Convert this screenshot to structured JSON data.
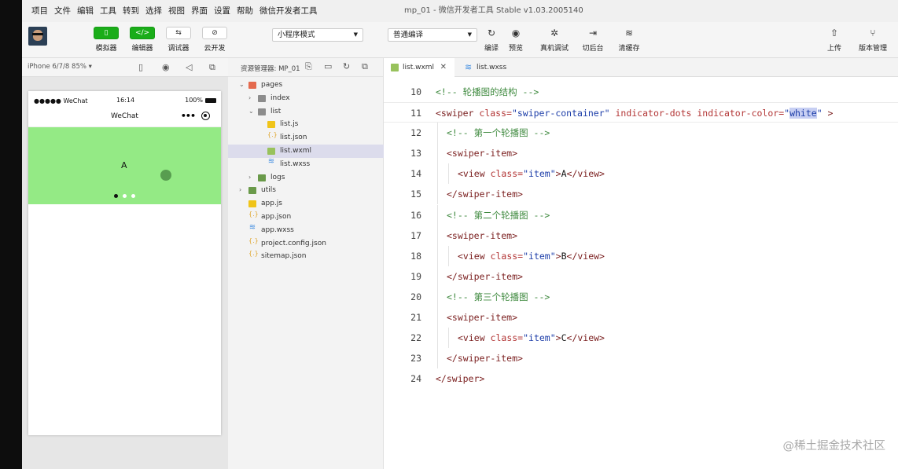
{
  "window": {
    "title": "mp_01 - 微信开发者工具 Stable v1.03.2005140"
  },
  "menu": [
    "项目",
    "文件",
    "编辑",
    "工具",
    "转到",
    "选择",
    "视图",
    "界面",
    "设置",
    "帮助",
    "微信开发者工具"
  ],
  "toolbar": {
    "simulator": {
      "label": "模拟器",
      "glyph": "▯"
    },
    "editor": {
      "label": "编辑器",
      "glyph": "</>"
    },
    "debugger": {
      "label": "调试器",
      "glyph": "⇆"
    },
    "cloud": {
      "label": "云开发",
      "glyph": "⊘"
    },
    "mode_select": "小程序模式",
    "compile_select": "普通编译",
    "compile": {
      "label": "编译",
      "glyph": "↻"
    },
    "preview": {
      "label": "预览",
      "glyph": "◉"
    },
    "remote_debug": {
      "label": "真机调试",
      "glyph": "✲"
    },
    "background": {
      "label": "切后台",
      "glyph": "⇥"
    },
    "clear_cache": {
      "label": "清缓存",
      "glyph": "≋"
    },
    "upload": {
      "label": "上传",
      "glyph": "⇧"
    },
    "version": {
      "label": "版本管理",
      "glyph": "⑂"
    }
  },
  "simulator": {
    "device": "iPhone 6/7/8 85% ▾",
    "status_signal": "●●●●● WeChat",
    "status_time": "16:14",
    "status_battery": "100%",
    "nav_title": "WeChat",
    "swiper_item": "A",
    "swiper_color": "#94ea85",
    "indicator_active": 0,
    "indicator_count": 3
  },
  "explorer": {
    "title": "资源管理器: MP_01",
    "tree": [
      {
        "name": "pages",
        "indent": 0,
        "arrow": "⌄",
        "icon": "foldr"
      },
      {
        "name": "index",
        "indent": 1,
        "arrow": "›",
        "icon": "fold"
      },
      {
        "name": "list",
        "indent": 1,
        "arrow": "⌄",
        "icon": "fold"
      },
      {
        "name": "list.js",
        "indent": 2,
        "arrow": "",
        "icon": "js"
      },
      {
        "name": "list.json",
        "indent": 2,
        "arrow": "",
        "icon": "json"
      },
      {
        "name": "list.wxml",
        "indent": 2,
        "arrow": "",
        "icon": "wxml",
        "selected": true
      },
      {
        "name": "list.wxss",
        "indent": 2,
        "arrow": "",
        "icon": "wxss"
      },
      {
        "name": "logs",
        "indent": 1,
        "arrow": "›",
        "icon": "foldg"
      },
      {
        "name": "utils",
        "indent": 0,
        "arrow": "›",
        "icon": "foldg"
      },
      {
        "name": "app.js",
        "indent": 0,
        "arrow": "",
        "icon": "js"
      },
      {
        "name": "app.json",
        "indent": 0,
        "arrow": "",
        "icon": "json"
      },
      {
        "name": "app.wxss",
        "indent": 0,
        "arrow": "",
        "icon": "wxss"
      },
      {
        "name": "project.config.json",
        "indent": 0,
        "arrow": "",
        "icon": "json"
      },
      {
        "name": "sitemap.json",
        "indent": 0,
        "arrow": "",
        "icon": "json"
      }
    ]
  },
  "editor": {
    "tabs": [
      {
        "label": "list.wxml",
        "active": true,
        "close": "✕"
      },
      {
        "label": "list.wxss",
        "active": false
      }
    ],
    "lines": [
      {
        "n": "10",
        "indent": 0,
        "tokens": [
          {
            "t": "<!-- 轮播图的结构 -->",
            "c": "com"
          }
        ]
      },
      {
        "n": "11",
        "indent": 0,
        "hl": true,
        "tokens": [
          {
            "t": "<swiper ",
            "c": "tag"
          },
          {
            "t": "class=",
            "c": "attr"
          },
          {
            "t": "\"swiper-container\"",
            "c": "str"
          },
          {
            "t": " indicator-dots ",
            "c": "attr"
          },
          {
            "t": "indicator-color=",
            "c": "attr"
          },
          {
            "t": "\"",
            "c": "str"
          },
          {
            "t": "white",
            "c": "str",
            "sel": true
          },
          {
            "t": "\" ",
            "c": "str"
          },
          {
            "t": ">",
            "c": "tag"
          }
        ]
      },
      {
        "n": "12",
        "indent": 1,
        "tokens": [
          {
            "t": "<!-- 第一个轮播图 -->",
            "c": "com"
          }
        ]
      },
      {
        "n": "13",
        "indent": 1,
        "tokens": [
          {
            "t": "<swiper-item>",
            "c": "tag"
          }
        ]
      },
      {
        "n": "14",
        "indent": 2,
        "tokens": [
          {
            "t": "<view ",
            "c": "tag"
          },
          {
            "t": "class=",
            "c": "attr"
          },
          {
            "t": "\"item\"",
            "c": "str"
          },
          {
            "t": ">",
            "c": "tag"
          },
          {
            "t": "A",
            "c": "txt"
          },
          {
            "t": "</view>",
            "c": "tag"
          }
        ]
      },
      {
        "n": "15",
        "indent": 1,
        "tokens": [
          {
            "t": "</swiper-item>",
            "c": "tag"
          }
        ]
      },
      {
        "n": "16",
        "indent": 1,
        "tokens": [
          {
            "t": "<!-- 第二个轮播图 -->",
            "c": "com"
          }
        ]
      },
      {
        "n": "17",
        "indent": 1,
        "tokens": [
          {
            "t": "<swiper-item>",
            "c": "tag"
          }
        ]
      },
      {
        "n": "18",
        "indent": 2,
        "tokens": [
          {
            "t": "<view ",
            "c": "tag"
          },
          {
            "t": "class=",
            "c": "attr"
          },
          {
            "t": "\"item\"",
            "c": "str"
          },
          {
            "t": ">",
            "c": "tag"
          },
          {
            "t": "B",
            "c": "txt"
          },
          {
            "t": "</view>",
            "c": "tag"
          }
        ]
      },
      {
        "n": "19",
        "indent": 1,
        "tokens": [
          {
            "t": "</swiper-item>",
            "c": "tag"
          }
        ]
      },
      {
        "n": "20",
        "indent": 1,
        "tokens": [
          {
            "t": "<!-- 第三个轮播图 -->",
            "c": "com"
          }
        ]
      },
      {
        "n": "21",
        "indent": 1,
        "tokens": [
          {
            "t": "<swiper-item>",
            "c": "tag"
          }
        ]
      },
      {
        "n": "22",
        "indent": 2,
        "tokens": [
          {
            "t": "<view ",
            "c": "tag"
          },
          {
            "t": "class=",
            "c": "attr"
          },
          {
            "t": "\"item\"",
            "c": "str"
          },
          {
            "t": ">",
            "c": "tag"
          },
          {
            "t": "C",
            "c": "txt"
          },
          {
            "t": "</view>",
            "c": "tag"
          }
        ]
      },
      {
        "n": "23",
        "indent": 1,
        "tokens": [
          {
            "t": "</swiper-item>",
            "c": "tag"
          }
        ]
      },
      {
        "n": "24",
        "indent": 0,
        "tokens": [
          {
            "t": "</swiper>",
            "c": "tag"
          }
        ]
      }
    ]
  },
  "watermark": "@稀土掘金技术社区"
}
